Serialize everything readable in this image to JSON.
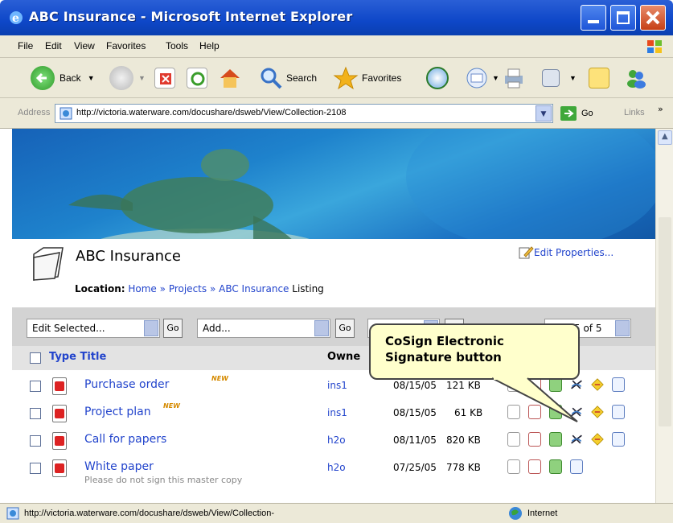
{
  "window": {
    "title": "ABC Insurance - Microsoft Internet Explorer"
  },
  "menu": [
    "File",
    "Edit",
    "View",
    "Favorites",
    "Tools",
    "Help"
  ],
  "toolbar": {
    "back": "Back",
    "search": "Search",
    "favorites": "Favorites"
  },
  "address": {
    "label": "Address",
    "url": "http://victoria.waterware.com/docushare/dsweb/View/Collection-2108",
    "go": "Go",
    "links": "Links"
  },
  "page": {
    "title": "ABC Insurance",
    "edit_properties": "Edit Properties...",
    "location_label": "Location:",
    "breadcrumb": [
      "Home",
      "Projects",
      "ABC Insurance"
    ],
    "breadcrumb_sep": "»",
    "listing": "Listing",
    "controls": {
      "edit_selected": "Edit Selected...",
      "go": "Go",
      "add": "Add...",
      "paging": "5 of 5"
    },
    "columns": {
      "type_title": "Type Title",
      "owner": "Owne"
    },
    "rows": [
      {
        "title": "Purchase order",
        "owner": "ins1",
        "date": "08/15/05",
        "size": "121 KB",
        "note": ""
      },
      {
        "title": "Project plan",
        "owner": "ins1",
        "date": "08/15/05",
        "size": "61 KB",
        "note": ""
      },
      {
        "title": "Call for papers",
        "owner": "h2o",
        "date": "08/11/05",
        "size": "820 KB",
        "note": ""
      },
      {
        "title": "White paper",
        "owner": "h2o",
        "date": "07/25/05",
        "size": "778 KB",
        "note": "Please do not sign this master copy"
      }
    ],
    "new_badge": "NEW"
  },
  "callout": {
    "line1": "CoSign Electronic",
    "line2": "Signature button"
  },
  "status": {
    "url": "http://victoria.waterware.com/docushare/dsweb/View/Collection-",
    "zone": "Internet"
  },
  "colors": {
    "link": "#2244cc",
    "titlebar": "#0e47c8",
    "callout": "#ffffcc"
  }
}
